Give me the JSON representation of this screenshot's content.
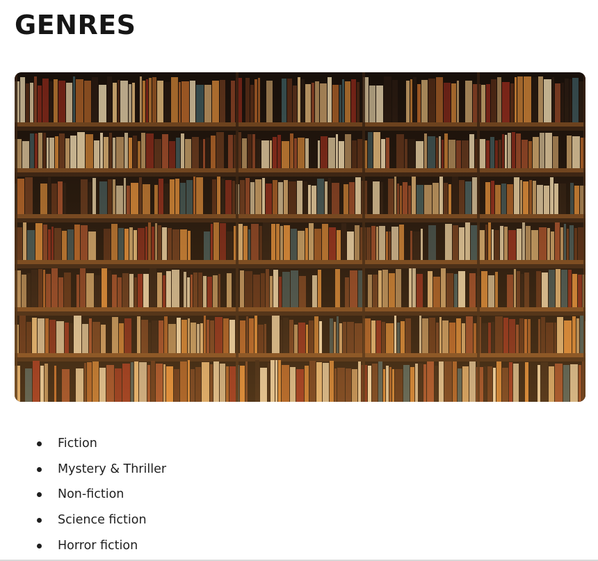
{
  "page": {
    "title": "GENRES"
  },
  "hero_image": {
    "subject": "library bookshelves photo",
    "palette": {
      "shelf": "#3b2414",
      "shelf_edge": "#7a4a22",
      "back": "#1c120c",
      "warm": "#d98a3a",
      "cream": "#e8d2a8",
      "red": "#8e2a1c",
      "dark": "#2b1b12",
      "teal": "#3f5a5e"
    }
  },
  "genres": {
    "items": [
      {
        "label": "Fiction"
      },
      {
        "label": "Mystery & Thriller"
      },
      {
        "label": "Non-fiction"
      },
      {
        "label": "Science fiction"
      },
      {
        "label": "Horror fiction"
      }
    ]
  }
}
